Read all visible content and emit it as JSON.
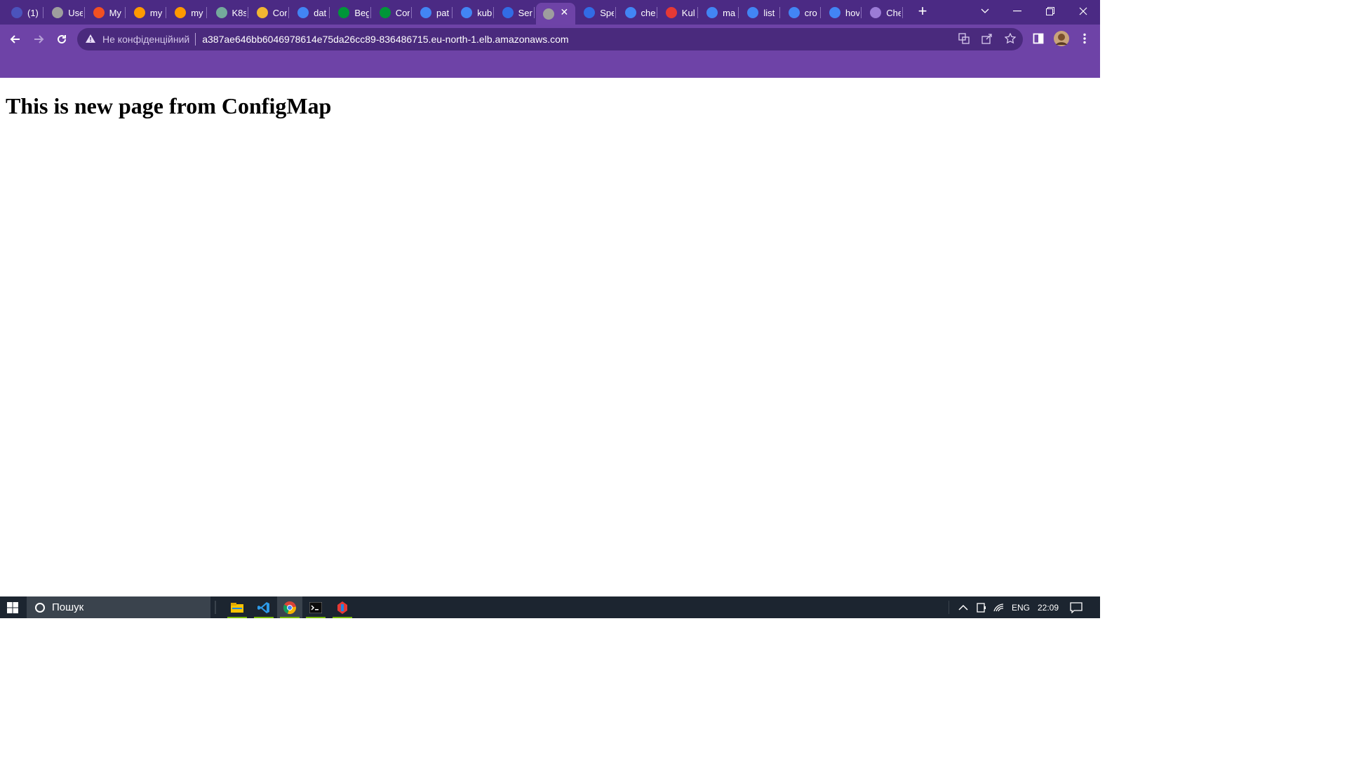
{
  "browser": {
    "tabs": [
      {
        "title": "(1)",
        "icon": "teams-icon",
        "color": "#4b53bc"
      },
      {
        "title": "Use",
        "icon": "globe-icon",
        "color": "#9e9e9e"
      },
      {
        "title": "My",
        "icon": "microsoft-icon",
        "color": "#f25022"
      },
      {
        "title": "my",
        "icon": "aws-icon",
        "color": "#ff9900"
      },
      {
        "title": "my",
        "icon": "aws-icon",
        "color": "#ff9900"
      },
      {
        "title": "K8s",
        "icon": "chatgpt-icon",
        "color": "#74aa9c"
      },
      {
        "title": "Cor",
        "icon": "box-icon",
        "color": "#f2b632"
      },
      {
        "title": "dat",
        "icon": "google-icon",
        "color": "#4285f4"
      },
      {
        "title": "Beg",
        "icon": "nginx-icon",
        "color": "#009639"
      },
      {
        "title": "Cor",
        "icon": "nginx-icon",
        "color": "#009639"
      },
      {
        "title": "pat",
        "icon": "google-icon",
        "color": "#4285f4"
      },
      {
        "title": "kub",
        "icon": "google-icon",
        "color": "#4285f4"
      },
      {
        "title": "Ser",
        "icon": "kubernetes-icon",
        "color": "#326ce5"
      },
      {
        "title": "",
        "icon": "globe-icon",
        "color": "#9e9e9e",
        "active": true
      },
      {
        "title": "Spe",
        "icon": "kubernetes-icon",
        "color": "#326ce5"
      },
      {
        "title": "che",
        "icon": "google-icon",
        "color": "#4285f4"
      },
      {
        "title": "Kul",
        "icon": "eye-icon",
        "color": "#e53935"
      },
      {
        "title": "ma",
        "icon": "google-icon",
        "color": "#4285f4"
      },
      {
        "title": "list",
        "icon": "google-icon",
        "color": "#4285f4"
      },
      {
        "title": "cro",
        "icon": "google-icon",
        "color": "#4285f4"
      },
      {
        "title": "hov",
        "icon": "google-icon",
        "color": "#4285f4"
      },
      {
        "title": "Che",
        "icon": "flask-icon",
        "color": "#9b7bd6"
      }
    ],
    "new_tab_label": "+",
    "omnibox": {
      "security_text": "Не конфіденційний",
      "url": "a387ae646bb6046978614e75da26cc89-836486715.eu-north-1.elb.amazonaws.com"
    },
    "colors": {
      "tabstrip": "#4b2a84",
      "toolbar": "#6e43a7"
    }
  },
  "page": {
    "heading": "This is new page from ConfigMap"
  },
  "taskbar": {
    "search_placeholder": "Пошук",
    "language": "ENG",
    "time": "22:09",
    "apps": [
      "file-explorer-icon",
      "vscode-icon",
      "chrome-icon",
      "terminal-icon",
      "app-icon"
    ]
  }
}
